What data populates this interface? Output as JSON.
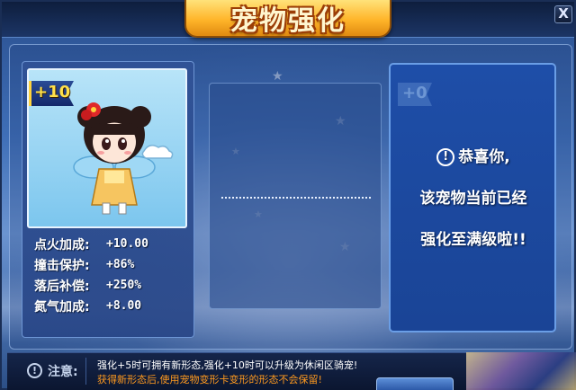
{
  "window": {
    "title": "宠物强化",
    "close_label": "X"
  },
  "pet": {
    "level": "+10",
    "stats": [
      {
        "label": "点火加成:",
        "value": "+10.00"
      },
      {
        "label": "撞击保护:",
        "value": "+86%"
      },
      {
        "label": "落后补偿:",
        "value": "+250%"
      },
      {
        "label": "氮气加成:",
        "value": "+8.00"
      }
    ]
  },
  "result": {
    "level": "+0",
    "message_lines": [
      "恭喜你,",
      "该宠物当前已经",
      "强化至满级啦!!"
    ]
  },
  "notice": {
    "label": "注意:",
    "line1": "强化+5时可拥有新形态,强化+10时可以升级为休闲区骑宠!",
    "line2": "获得新形态后,使用宠物变形卡变形的形态不会保留!"
  },
  "colors": {
    "title_gold": "#ffb52a",
    "level_yellow": "#ffe04a",
    "warning_orange": "#ff9a1f"
  }
}
